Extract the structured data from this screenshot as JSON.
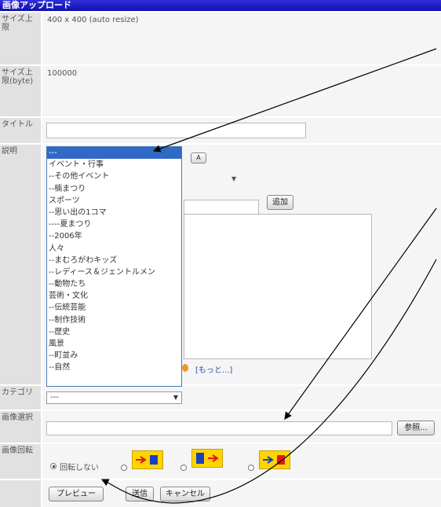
{
  "title": "画像アップロード",
  "rows": {
    "size_label": "サイズ上限",
    "size_value": "400 x 400 (auto resize)",
    "bytes_label": "サイズ上限(byte)",
    "bytes_value": "100000",
    "title_label": "タイトル",
    "desc_label": "説明",
    "category_label": "カテゴリ",
    "file_label": "画像選択",
    "rotate_label": "画像回転"
  },
  "dropdown": {
    "options": [
      "---",
      "イベント・行事",
      "--その他イベント",
      "--楠まつり",
      "スポーツ",
      "--思い出の1コマ",
      "----夏まつり",
      "--2006年",
      "人々",
      "--まむろがわキッズ",
      "--レディース＆ジェントルメン",
      "--動物たち",
      "芸術・文化",
      "--伝統芸能",
      "--制作技術",
      "--歴史",
      "風景",
      "--町並み",
      "--自然"
    ],
    "selected": "---"
  },
  "category_select": "---",
  "partially_hidden": {
    "add_button": "追加",
    "more_link": "[もっと...]"
  },
  "file": {
    "browse_button": "参照..."
  },
  "rotate": {
    "no_rotate_label": "回転しない"
  },
  "buttons": {
    "preview": "プレビュー",
    "send": "送信",
    "cancel": "キャンセル"
  },
  "colors": {
    "title_bar": "#1a1ac8",
    "label_bg": "#e1e1e1",
    "cell_bg": "#f5f5f5",
    "selected_option": "#3169c6",
    "rotate_icon": "#ffd500"
  }
}
